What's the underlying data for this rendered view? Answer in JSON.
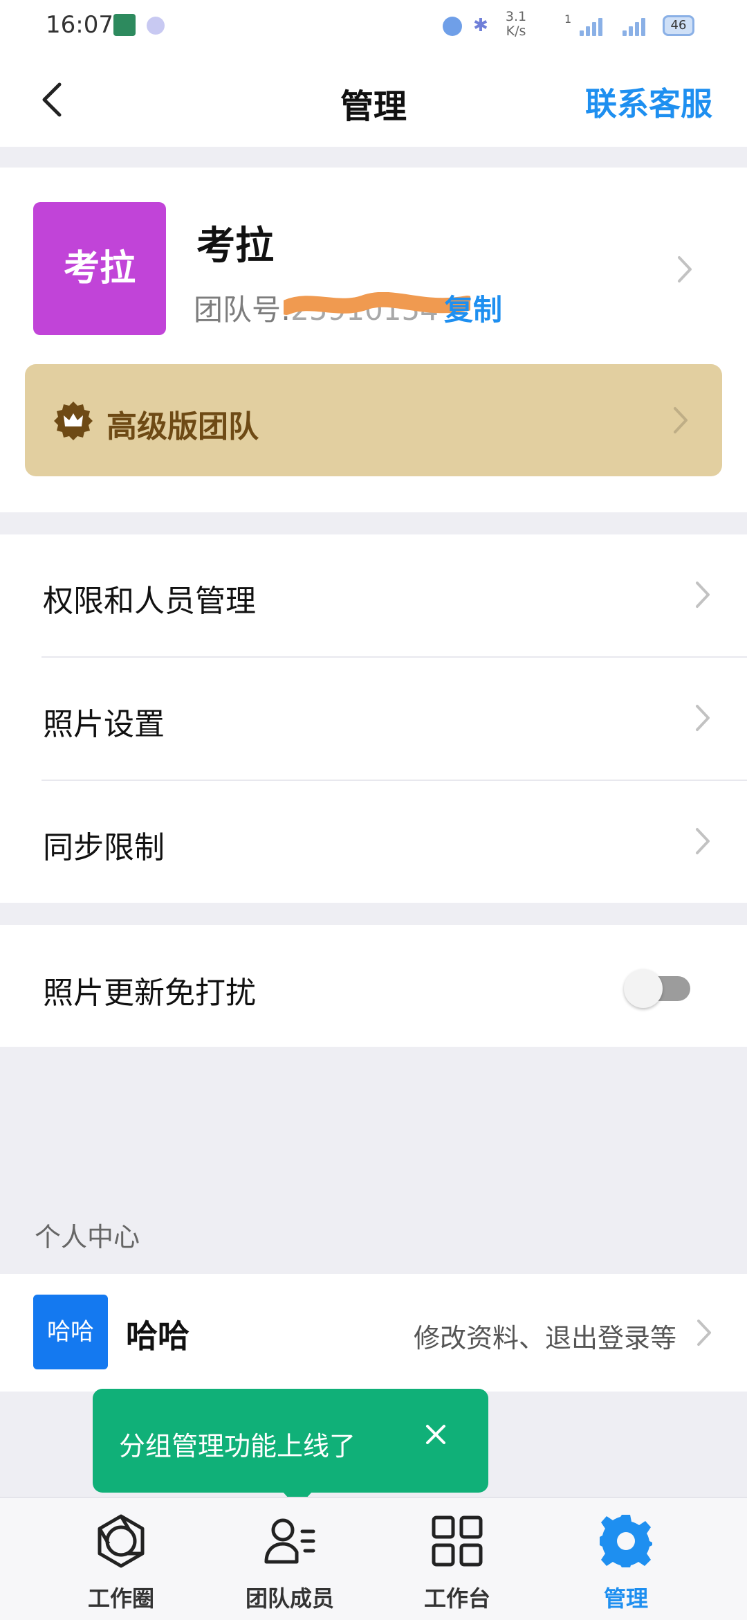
{
  "status_bar": {
    "time": "16:07",
    "net_speed_value": "3.1",
    "net_speed_unit": "K/s",
    "sim_label": "1",
    "battery": "46"
  },
  "nav": {
    "title": "管理",
    "service_label": "联系客服"
  },
  "team": {
    "logo_text": "考拉",
    "name": "考拉",
    "id_label": "团队号:",
    "id_value": "25910154",
    "copy_label": "复制",
    "premium_label": "高级版团队"
  },
  "menu": {
    "items": [
      {
        "label": "权限和人员管理"
      },
      {
        "label": "照片设置"
      },
      {
        "label": "同步限制"
      }
    ],
    "dnd_label": "照片更新免打扰",
    "dnd_enabled": false
  },
  "personal": {
    "section_title": "个人中心",
    "avatar_text": "哈哈",
    "name": "哈哈",
    "hint": "修改资料、退出登录等"
  },
  "toast": {
    "text": "分组管理功能上线了",
    "close_icon": "close-icon"
  },
  "tabs": [
    {
      "label": "工作圈",
      "icon": "aperture-icon",
      "active": false
    },
    {
      "label": "团队成员",
      "icon": "team-members-icon",
      "active": false
    },
    {
      "label": "工作台",
      "icon": "grid-icon",
      "active": false
    },
    {
      "label": "管理",
      "icon": "gear-icon",
      "active": true
    }
  ],
  "colors": {
    "accent": "#1e8ff0",
    "team_logo": "#c144d8",
    "premium_bg": "#e2cfa0",
    "premium_text": "#6e4a15",
    "toast_bg": "#10b078",
    "avatar_bg": "#1479f0"
  }
}
